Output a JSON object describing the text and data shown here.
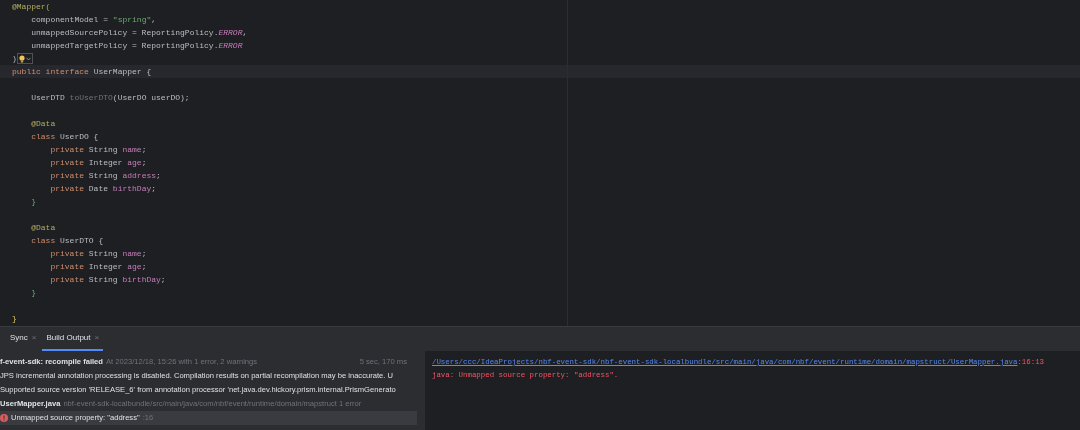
{
  "editor": {
    "lines": [
      {
        "kind": "code",
        "current": false,
        "tokens": [
          {
            "kind": "annotation",
            "text": "@Mapper("
          }
        ]
      },
      {
        "kind": "code",
        "current": false,
        "tokens": [
          {
            "kind": "plain",
            "text": "    componentModel = "
          },
          {
            "kind": "string",
            "text": "\"spring\""
          },
          {
            "kind": "plain",
            "text": ","
          }
        ]
      },
      {
        "kind": "code",
        "current": false,
        "tokens": [
          {
            "kind": "plain",
            "text": "    unmappedSourcePolicy = ReportingPolicy."
          },
          {
            "kind": "constant",
            "text": "ERROR"
          },
          {
            "kind": "plain",
            "text": ","
          }
        ]
      },
      {
        "kind": "code",
        "current": false,
        "tokens": [
          {
            "kind": "plain",
            "text": "    unmappedTargetPolicy = ReportingPolicy."
          },
          {
            "kind": "constant",
            "text": "ERROR"
          }
        ]
      },
      {
        "kind": "code",
        "current": false,
        "tokens": [
          {
            "kind": "plain",
            "text": ")"
          },
          {
            "kind": "bulb"
          }
        ]
      },
      {
        "kind": "code",
        "current": true,
        "tokens": [
          {
            "kind": "keyword",
            "text": "public interface "
          },
          {
            "kind": "plain",
            "text": "UserMapper {"
          }
        ]
      },
      {
        "kind": "blank",
        "current": false
      },
      {
        "kind": "code",
        "current": false,
        "tokens": [
          {
            "kind": "plain",
            "text": "    UserDTD "
          },
          {
            "kind": "unused",
            "text": "toUserDTO"
          },
          {
            "kind": "plain",
            "text": "(UserDO userDO);"
          }
        ]
      },
      {
        "kind": "blank",
        "current": false
      },
      {
        "kind": "code",
        "current": false,
        "tokens": [
          {
            "kind": "annotation",
            "text": "    @Data"
          }
        ]
      },
      {
        "kind": "code",
        "current": false,
        "tokens": [
          {
            "kind": "keyword",
            "text": "    class "
          },
          {
            "kind": "plain",
            "text": "UserDO {"
          }
        ]
      },
      {
        "kind": "code",
        "current": false,
        "tokens": [
          {
            "kind": "keyword",
            "text": "        private "
          },
          {
            "kind": "plain",
            "text": "String "
          },
          {
            "kind": "field",
            "text": "name"
          },
          {
            "kind": "plain",
            "text": ";"
          }
        ]
      },
      {
        "kind": "code",
        "current": false,
        "tokens": [
          {
            "kind": "keyword",
            "text": "        private "
          },
          {
            "kind": "plain",
            "text": "Integer "
          },
          {
            "kind": "field",
            "text": "age"
          },
          {
            "kind": "plain",
            "text": ";"
          }
        ]
      },
      {
        "kind": "code",
        "current": false,
        "tokens": [
          {
            "kind": "keyword",
            "text": "        private "
          },
          {
            "kind": "plain",
            "text": "String "
          },
          {
            "kind": "field",
            "text": "address"
          },
          {
            "kind": "plain",
            "text": ";"
          }
        ]
      },
      {
        "kind": "code",
        "current": false,
        "tokens": [
          {
            "kind": "keyword",
            "text": "        private "
          },
          {
            "kind": "plain",
            "text": "Date "
          },
          {
            "kind": "field",
            "text": "birthDay"
          },
          {
            "kind": "plain",
            "text": ";"
          }
        ]
      },
      {
        "kind": "code",
        "current": false,
        "tokens": [
          {
            "kind": "brace",
            "text": "    }"
          }
        ]
      },
      {
        "kind": "blank",
        "current": false
      },
      {
        "kind": "code",
        "current": false,
        "tokens": [
          {
            "kind": "annotation",
            "text": "    @Data"
          }
        ]
      },
      {
        "kind": "code",
        "current": false,
        "tokens": [
          {
            "kind": "keyword",
            "text": "    class "
          },
          {
            "kind": "plain",
            "text": "UserDTO {"
          }
        ]
      },
      {
        "kind": "code",
        "current": false,
        "tokens": [
          {
            "kind": "keyword",
            "text": "        private "
          },
          {
            "kind": "plain",
            "text": "String "
          },
          {
            "kind": "field",
            "text": "name"
          },
          {
            "kind": "plain",
            "text": ";"
          }
        ]
      },
      {
        "kind": "code",
        "current": false,
        "tokens": [
          {
            "kind": "keyword",
            "text": "        private "
          },
          {
            "kind": "plain",
            "text": "Integer "
          },
          {
            "kind": "field",
            "text": "age"
          },
          {
            "kind": "plain",
            "text": ";"
          }
        ]
      },
      {
        "kind": "code",
        "current": false,
        "tokens": [
          {
            "kind": "keyword",
            "text": "        private "
          },
          {
            "kind": "plain",
            "text": "String "
          },
          {
            "kind": "field",
            "text": "birthDay"
          },
          {
            "kind": "plain",
            "text": ";"
          }
        ]
      },
      {
        "kind": "code",
        "current": false,
        "tokens": [
          {
            "kind": "brace",
            "text": "    }"
          }
        ]
      },
      {
        "kind": "blank",
        "current": false
      },
      {
        "kind": "code",
        "current": false,
        "tokens": [
          {
            "kind": "closing",
            "text": "}"
          }
        ]
      }
    ]
  },
  "tool_window": {
    "tabs": [
      {
        "label": "Sync",
        "close": "×",
        "selected": false
      },
      {
        "label": "Build Output",
        "close": "×",
        "selected": true
      }
    ],
    "tree": [
      {
        "kind": "summary",
        "title": "f-event-sdk: recompile failed",
        "detail": "At 2023/12/18, 15:26 with 1 error, 2 warnings",
        "time": "5 sec, 170 ms",
        "selected": false
      },
      {
        "kind": "message",
        "title": "JPS incremental annotation processing is disabled. Compilation results on partial recompilation may be inaccurate. U",
        "selected": false
      },
      {
        "kind": "message",
        "title": "Supported source version 'RELEASE_6' from annotation processor 'net.java.dev.hickory.prism.internal.PrismGenerato",
        "selected": false
      },
      {
        "kind": "file",
        "title": "UserMapper.java",
        "detail": "nbf-event-sdk-localbundle/src/main/java/com/nbf/event/runtime/domain/mapstruct 1 error",
        "selected": false
      },
      {
        "kind": "error",
        "title": "Unmapped source property: \"address\"",
        "detail": ":16",
        "selected": true
      }
    ],
    "console": {
      "link": "/Users/ccc/IdeaProjects/nbf-event-sdk/nbf-event-sdk-localbundle/src/main/java/com/nbf/event/runtime/domain/mapstruct/UserMapper.java",
      "position": ":16:13",
      "error": "java: Unmapped source property: \"address\"."
    }
  }
}
